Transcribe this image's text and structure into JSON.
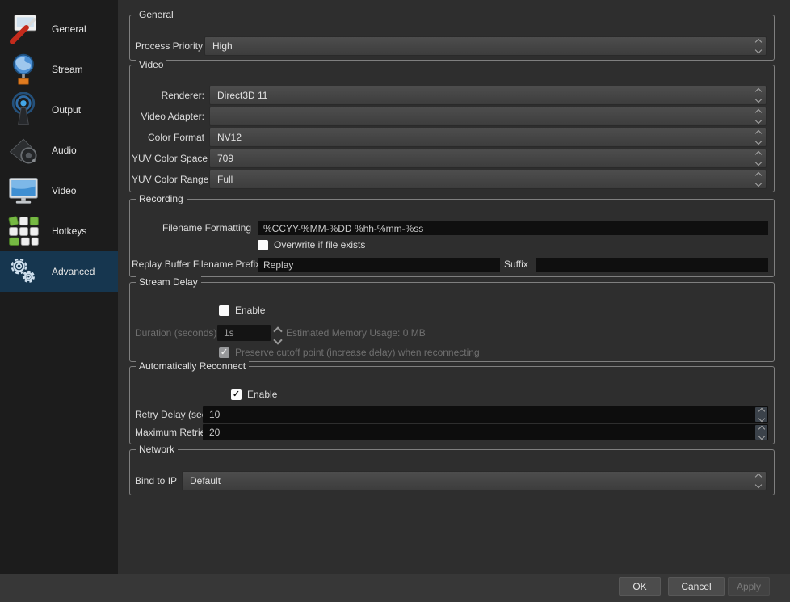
{
  "colors": {
    "sidebar_bg": "#1c1c1c",
    "selected_item_bg": "#16364f",
    "content_bg": "#2e2e2e",
    "window_bg": "#373737",
    "input_bg": "#0f0f0f",
    "hotkey_green": "#76b943"
  },
  "sidebar": {
    "items": [
      {
        "label": "General",
        "icon": "general-icon",
        "selected": false
      },
      {
        "label": "Stream",
        "icon": "stream-icon",
        "selected": false
      },
      {
        "label": "Output",
        "icon": "output-icon",
        "selected": false
      },
      {
        "label": "Audio",
        "icon": "audio-icon",
        "selected": false
      },
      {
        "label": "Video",
        "icon": "video-icon",
        "selected": false
      },
      {
        "label": "Hotkeys",
        "icon": "hotkeys-icon",
        "selected": false
      },
      {
        "label": "Advanced",
        "icon": "advanced-icon",
        "selected": true
      }
    ]
  },
  "general": {
    "title": "General",
    "process_priority": {
      "label": "Process Priority",
      "value": "High"
    }
  },
  "video": {
    "title": "Video",
    "rows": [
      {
        "label": "Renderer:",
        "value": "Direct3D 11"
      },
      {
        "label": "Video Adapter:",
        "value": ""
      },
      {
        "label": "Color Format",
        "value": "NV12"
      },
      {
        "label": "YUV Color Space",
        "value": "709"
      },
      {
        "label": "YUV Color Range",
        "value": "Full"
      }
    ]
  },
  "recording": {
    "title": "Recording",
    "filename_formatting": {
      "label": "Filename Formatting",
      "value": "%CCYY-%MM-%DD %hh-%mm-%ss"
    },
    "overwrite": {
      "label": "Overwrite if file exists",
      "checked": false
    },
    "replay_prefix": {
      "label": "Replay Buffer Filename Prefix",
      "value": "Replay"
    },
    "replay_suffix": {
      "label": "Suffix",
      "value": ""
    }
  },
  "stream_delay": {
    "title": "Stream Delay",
    "enable": {
      "label": "Enable",
      "checked": false
    },
    "duration": {
      "label": "Duration (seconds)",
      "value": "1s",
      "disabled": true
    },
    "memory_usage": "Estimated Memory Usage: 0 MB",
    "preserve": {
      "label": "Preserve cutoff point (increase delay) when reconnecting",
      "checked": true,
      "disabled": true
    }
  },
  "auto_reconnect": {
    "title": "Automatically Reconnect",
    "enable": {
      "label": "Enable",
      "checked": true
    },
    "retry_delay": {
      "label": "Retry Delay (seconds)",
      "value": "10"
    },
    "max_retries": {
      "label": "Maximum Retries",
      "value": "20"
    }
  },
  "network": {
    "title": "Network",
    "bind_to_ip": {
      "label": "Bind to IP",
      "value": "Default"
    }
  },
  "footer": {
    "ok_label": "OK",
    "cancel_label": "Cancel",
    "apply_label": "Apply",
    "apply_enabled": false
  }
}
